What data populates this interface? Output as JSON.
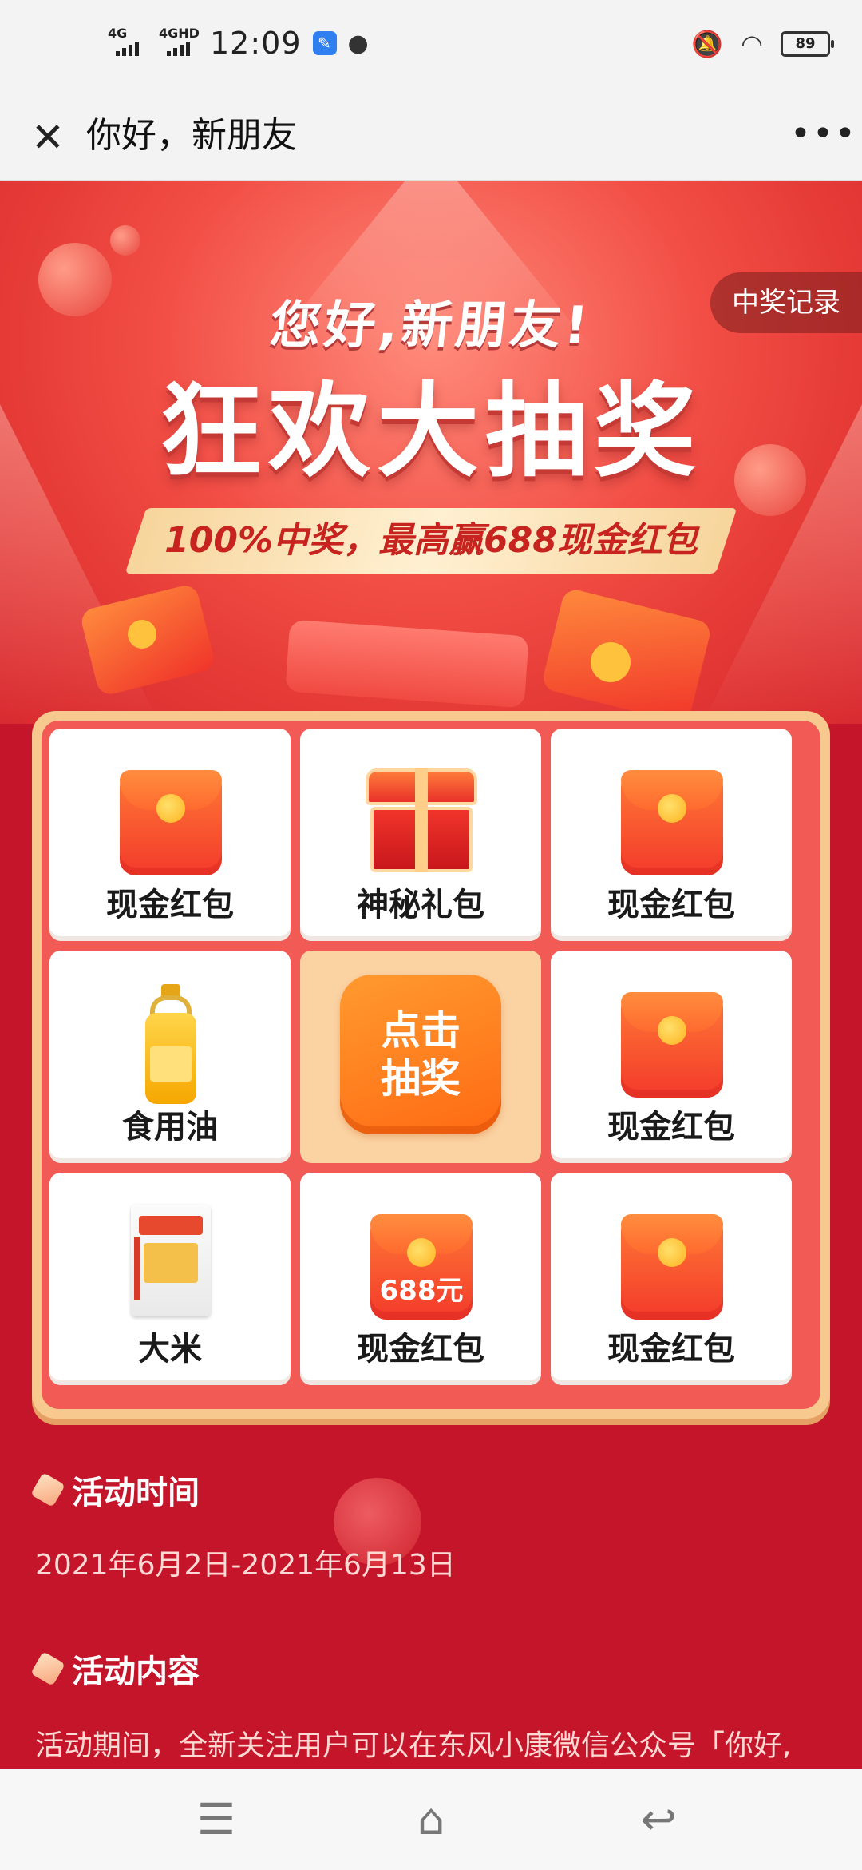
{
  "status_bar": {
    "signal1": "4G",
    "signal2": "4GHD",
    "time": "12:09",
    "battery": "89"
  },
  "header": {
    "title": "你好，新朋友",
    "close_icon": "close-icon",
    "more_icon": "more-icon"
  },
  "hero": {
    "record_button": "中奖记录",
    "greeting": "您好,新朋友!",
    "headline": "狂欢大抽奖",
    "ribbon": "100%中奖，最高赢688现金红包"
  },
  "prizes": [
    {
      "label": "现金红包",
      "icon": "red-envelope-icon"
    },
    {
      "label": "神秘礼包",
      "icon": "treasure-chest-icon"
    },
    {
      "label": "现金红包",
      "icon": "red-envelope-icon"
    },
    {
      "label": "食用油",
      "icon": "cooking-oil-icon"
    },
    {
      "label": "现金红包",
      "icon": "red-envelope-icon"
    },
    {
      "label": "大米",
      "icon": "rice-bag-icon"
    },
    {
      "label": "现金红包",
      "icon": "red-envelope-icon",
      "amount": "688元"
    },
    {
      "label": "现金红包",
      "icon": "red-envelope-icon"
    }
  ],
  "draw_button": {
    "line1": "点击",
    "line2": "抽奖"
  },
  "activity_time": {
    "title": "活动时间",
    "value": "2021年6月2日-2021年6月13日"
  },
  "activity_content": {
    "title": "活动内容",
    "value": "活动期间，全新关注用户可以在东风小康微信公众号「你好,"
  },
  "nav": {
    "menu_icon": "menu-icon",
    "home_icon": "home-icon",
    "back_icon": "back-icon"
  },
  "colors": {
    "background": "#c4152a",
    "accent": "#ff7a1a",
    "board": "#f8c98e"
  }
}
